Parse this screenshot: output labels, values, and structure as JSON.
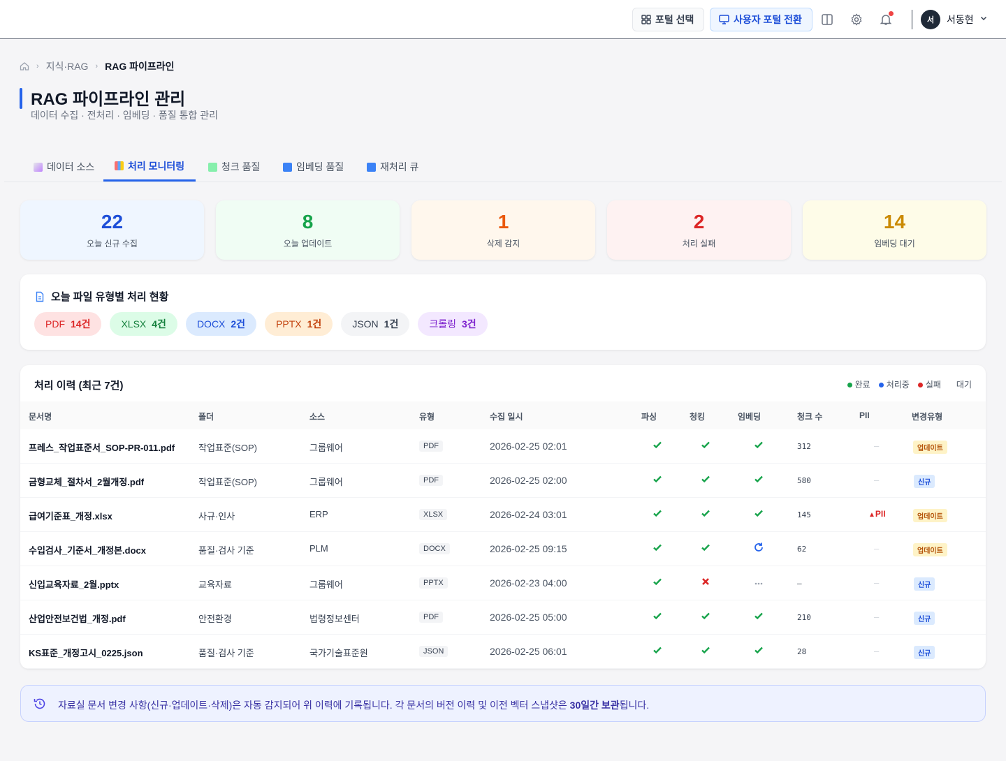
{
  "topbar": {
    "portal_select": "포털 선택",
    "user_portal_switch": "사용자 포털 전환",
    "user_initial": "서",
    "user_name": "서동현"
  },
  "breadcrumb": [
    "지식·RAG",
    "RAG 파이프라인"
  ],
  "page": {
    "title": "RAG 파이프라인 관리",
    "subtitle": "데이터 수집 · 전처리 · 임베딩 · 품질 통합 관리"
  },
  "tabs": [
    {
      "label": "데이터 소스",
      "active": false
    },
    {
      "label": "처리 모니터링",
      "active": true
    },
    {
      "label": "청크 품질",
      "active": false
    },
    {
      "label": "임베딩 품질",
      "active": false
    },
    {
      "label": "재처리 큐",
      "active": false
    }
  ],
  "stats": [
    {
      "value": "22",
      "label": "오늘 신규 수집",
      "color": "#1d4ed8",
      "bg": "#eff6ff"
    },
    {
      "value": "8",
      "label": "오늘 업데이트",
      "color": "#16a34a",
      "bg": "#f0fdf4"
    },
    {
      "value": "1",
      "label": "삭제 감지",
      "color": "#ea580c",
      "bg": "#fff7ed"
    },
    {
      "value": "2",
      "label": "처리 실패",
      "color": "#dc2626",
      "bg": "#fef2f2"
    },
    {
      "value": "14",
      "label": "임베딩 대기",
      "color": "#ca8a04",
      "bg": "#fefce8"
    }
  ],
  "file_types": {
    "heading": "오늘 파일 유형별 처리 현황",
    "chips": [
      {
        "type": "PDF",
        "count": "14건",
        "color": "#dc2626",
        "bg": "#fee2e2"
      },
      {
        "type": "XLSX",
        "count": "4건",
        "color": "#15803d",
        "bg": "#dcfce7"
      },
      {
        "type": "DOCX",
        "count": "2건",
        "color": "#1d4ed8",
        "bg": "#dbeafe"
      },
      {
        "type": "PPTX",
        "count": "1건",
        "color": "#c2410c",
        "bg": "#ffedd5"
      },
      {
        "type": "JSON",
        "count": "1건",
        "color": "#374151",
        "bg": "#f3f4f6"
      },
      {
        "type": "크롤링",
        "count": "3건",
        "color": "#7e22ce",
        "bg": "#f3e8ff"
      }
    ]
  },
  "history": {
    "title": "처리 이력 (최근 7건)",
    "legend": [
      {
        "label": "완료",
        "color": "#16a34a"
      },
      {
        "label": "처리중",
        "color": "#2563eb"
      },
      {
        "label": "실패",
        "color": "#dc2626"
      },
      {
        "label": "대기",
        "color": ""
      }
    ],
    "columns": [
      "문서명",
      "폴더",
      "소스",
      "유형",
      "수집 일시",
      "파싱",
      "청킹",
      "임베딩",
      "청크 수",
      "PII",
      "변경유형"
    ],
    "rows": [
      {
        "name": "프레스_작업표준서_SOP-PR-011.pdf",
        "folder": "작업표준(SOP)",
        "source": "그룹웨어",
        "type": "PDF",
        "date": "2026-02-25 02:01",
        "parse": "done",
        "chunk": "done",
        "embed": "done",
        "chunks": "312",
        "pii": "–",
        "change": "업데이트",
        "change_kind": "upd"
      },
      {
        "name": "금형교체_절차서_2월개정.pdf",
        "folder": "작업표준(SOP)",
        "source": "그룹웨어",
        "type": "PDF",
        "date": "2026-02-25 02:00",
        "parse": "done",
        "chunk": "done",
        "embed": "done",
        "chunks": "580",
        "pii": "–",
        "change": "신규",
        "change_kind": "new"
      },
      {
        "name": "급여기준표_개정.xlsx",
        "folder": "사규·인사",
        "source": "ERP",
        "type": "XLSX",
        "date": "2026-02-24 03:01",
        "parse": "done",
        "chunk": "done",
        "embed": "done",
        "chunks": "145",
        "pii": "PII",
        "change": "업데이트",
        "change_kind": "upd"
      },
      {
        "name": "수입검사_기준서_개정본.docx",
        "folder": "품질·검사 기준",
        "source": "PLM",
        "type": "DOCX",
        "date": "2026-02-25 09:15",
        "parse": "done",
        "chunk": "done",
        "embed": "processing",
        "chunks": "62",
        "pii": "–",
        "change": "업데이트",
        "change_kind": "upd"
      },
      {
        "name": "신입교육자료_2월.pptx",
        "folder": "교육자료",
        "source": "그룹웨어",
        "type": "PPTX",
        "date": "2026-02-23 04:00",
        "parse": "done",
        "chunk": "failed",
        "embed": "waiting",
        "chunks": "–",
        "pii": "–",
        "change": "신규",
        "change_kind": "new"
      },
      {
        "name": "산업안전보건법_개정.pdf",
        "folder": "안전환경",
        "source": "법령정보센터",
        "type": "PDF",
        "date": "2026-02-25 05:00",
        "parse": "done",
        "chunk": "done",
        "embed": "done",
        "chunks": "210",
        "pii": "–",
        "change": "신규",
        "change_kind": "new"
      },
      {
        "name": "KS표준_개정고시_0225.json",
        "folder": "품질·검사 기준",
        "source": "국가기술표준원",
        "type": "JSON",
        "date": "2026-02-25 06:01",
        "parse": "done",
        "chunk": "done",
        "embed": "done",
        "chunks": "28",
        "pii": "–",
        "change": "신규",
        "change_kind": "new"
      }
    ]
  },
  "banner": {
    "text_before": "자료실 문서 변경 사항(신규·업데이트·삭제)은 자동 감지되어 위 이력에 기록됩니다. 각 문서의 버전 이력 및 이전 벡터 스냅샷은 ",
    "text_bold": "30일간 보관",
    "text_after": "됩니다."
  }
}
